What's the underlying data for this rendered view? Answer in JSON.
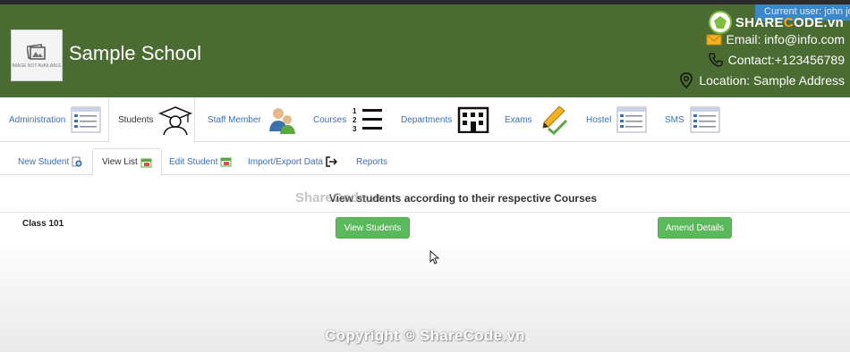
{
  "header": {
    "school_name": "Sample School",
    "logo_text": "IMAGE NOT AVAILABLE",
    "current_user": "Current user: john john",
    "email": "Email: info@info.com",
    "contact": "Contact:+123456789",
    "location": "Location: Sample Address",
    "brand_color": "#4a6b31"
  },
  "watermark": {
    "logo_text_a": "SHARE",
    "logo_text_b": "C",
    "logo_text_c": "ODE.vn",
    "mid_text": "ShareCode.vn",
    "copyright": "Copyright © ShareCode.vn"
  },
  "main_nav": {
    "items": [
      {
        "label": "Administration",
        "icon": "form-icon"
      },
      {
        "label": "Students",
        "icon": "graduate-icon"
      },
      {
        "label": "Staff Member",
        "icon": "staff-icon"
      },
      {
        "label": "Courses",
        "icon": "list-icon"
      },
      {
        "label": "Departments",
        "icon": "building-icon"
      },
      {
        "label": "Exams",
        "icon": "exam-icon"
      },
      {
        "label": "Hostel",
        "icon": "form-icon"
      },
      {
        "label": "SMS",
        "icon": "form-icon"
      }
    ],
    "active": "Students"
  },
  "sub_nav": {
    "tabs": [
      {
        "label": "New Student"
      },
      {
        "label": "View List"
      },
      {
        "label": "Edit Student"
      },
      {
        "label": "Import/Export Data"
      },
      {
        "label": "Reports"
      }
    ],
    "active": "View List"
  },
  "content": {
    "title": "View students according to their respective Courses",
    "class_name": "Class 101",
    "view_button": "View Students",
    "amend_button": "Amend Details"
  },
  "colors": {
    "accent_button": "#5cb85c",
    "link": "#3a6fb0",
    "user_badge": "#3b88c9"
  }
}
